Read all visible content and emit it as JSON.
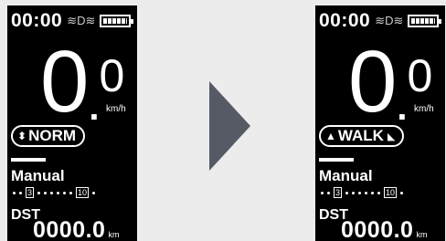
{
  "screens": [
    {
      "status": {
        "time": "00:00",
        "light_glyph": "≋D≋",
        "battery_icon": "battery-full-icon"
      },
      "speed": {
        "integer": "0",
        "dot": ".",
        "decimal": "0",
        "unit": "km/h"
      },
      "mode": {
        "label": "NORM",
        "arrow_glyph": "⬍"
      },
      "assist_label": "Manual",
      "scale": {
        "low": "3",
        "high": "10"
      },
      "trip": {
        "label": "DST",
        "value": "0000.0",
        "unit": "km"
      }
    },
    {
      "status": {
        "time": "00:00",
        "light_glyph": "≋D≋",
        "battery_icon": "battery-full-icon"
      },
      "speed": {
        "integer": "0",
        "dot": ".",
        "decimal": "0",
        "unit": "km/h"
      },
      "mode": {
        "label": "WALK",
        "arrow_glyph": "▲",
        "walk_glyph": "◣"
      },
      "assist_label": "Manual",
      "scale": {
        "low": "3",
        "high": "10"
      },
      "trip": {
        "label": "DST",
        "value": "0000.0",
        "unit": "km"
      }
    }
  ],
  "arrow_icon": "arrow-right-icon",
  "colors": {
    "screen_bg": "#000000",
    "text": "#ffffff",
    "page_bg": "#ececec",
    "arrow": "#555a64"
  }
}
